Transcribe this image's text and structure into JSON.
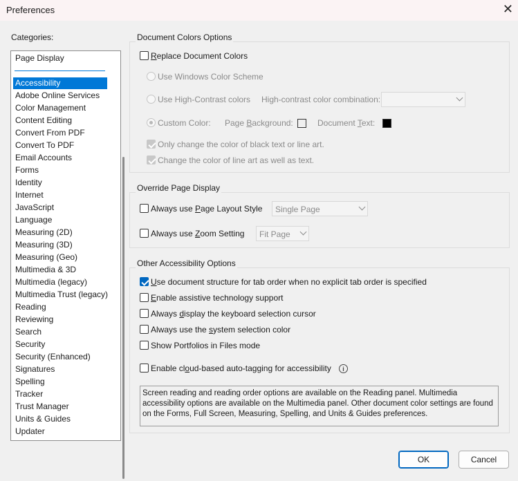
{
  "window": {
    "title": "Preferences",
    "close_glyph": "✕"
  },
  "categories": {
    "label": "Categories:",
    "pinned": "Page Display",
    "items": [
      "Accessibility",
      "Adobe Online Services",
      "Color Management",
      "Content Editing",
      "Convert From PDF",
      "Convert To PDF",
      "Email Accounts",
      "Forms",
      "Identity",
      "Internet",
      "JavaScript",
      "Language",
      "Measuring (2D)",
      "Measuring (3D)",
      "Measuring (Geo)",
      "Multimedia & 3D",
      "Multimedia (legacy)",
      "Multimedia Trust (legacy)",
      "Reading",
      "Reviewing",
      "Search",
      "Security",
      "Security (Enhanced)",
      "Signatures",
      "Spelling",
      "Tracker",
      "Trust Manager",
      "Units & Guides",
      "Updater"
    ],
    "selected": "Accessibility"
  },
  "doc_colors": {
    "title": "Document Colors Options",
    "replace_pre": "",
    "replace_u": "R",
    "replace_post": "eplace Document Colors",
    "windows_scheme": "Use Windows Color Scheme",
    "high_contrast": "Use High-Contrast colors",
    "hc_combo_label": "High-contrast color combination:",
    "hc_combo_value": "",
    "custom_color": "Custom Color:",
    "page_bg_pre": "Page ",
    "page_bg_u": "B",
    "page_bg_post": "ackground:",
    "page_bg_color": "#ffffff",
    "doc_text_pre": "Document ",
    "doc_text_u": "T",
    "doc_text_post": "ext:",
    "doc_text_color": "#000000",
    "only_black": "Only change the color of black text or line art.",
    "line_art": "Change the color of line art as well as text."
  },
  "override": {
    "title": "Override Page Display",
    "layout_pre": "Always use ",
    "layout_u": "P",
    "layout_post": "age Layout Style",
    "layout_value": "Single Page",
    "zoom_pre": "Always use ",
    "zoom_u": "Z",
    "zoom_post": "oom Setting",
    "zoom_value": "Fit Page"
  },
  "other": {
    "title": "Other Accessibility Options",
    "doc_structure_pre": "",
    "doc_structure_u": "U",
    "doc_structure_post": "se document structure for tab order when no explicit tab order is specified",
    "assistive_pre": "",
    "assistive_u": "E",
    "assistive_post": "nable assistive technology support",
    "keyboard_pre": "Always ",
    "keyboard_u": "d",
    "keyboard_post": "isplay the keyboard selection cursor",
    "system_color_pre": "Always use the ",
    "system_color_u": "s",
    "system_color_post": "ystem selection color",
    "portfolios": "Show Portfolios in Files mode",
    "cloud_pre": "Enable cl",
    "cloud_u": "o",
    "cloud_post": "ud-based auto-tagging for accessibility",
    "info_glyph": "i",
    "note": "Screen reading and reading order options are available on the Reading panel. Multimedia accessibility options are available on the Multimedia panel. Other document color settings are found on the Forms, Full Screen, Measuring, Spelling, and Units & Guides preferences."
  },
  "buttons": {
    "ok": "OK",
    "cancel": "Cancel"
  },
  "colors": {
    "accent": "#0078d7",
    "checkbox_checked": "#0067c0"
  }
}
